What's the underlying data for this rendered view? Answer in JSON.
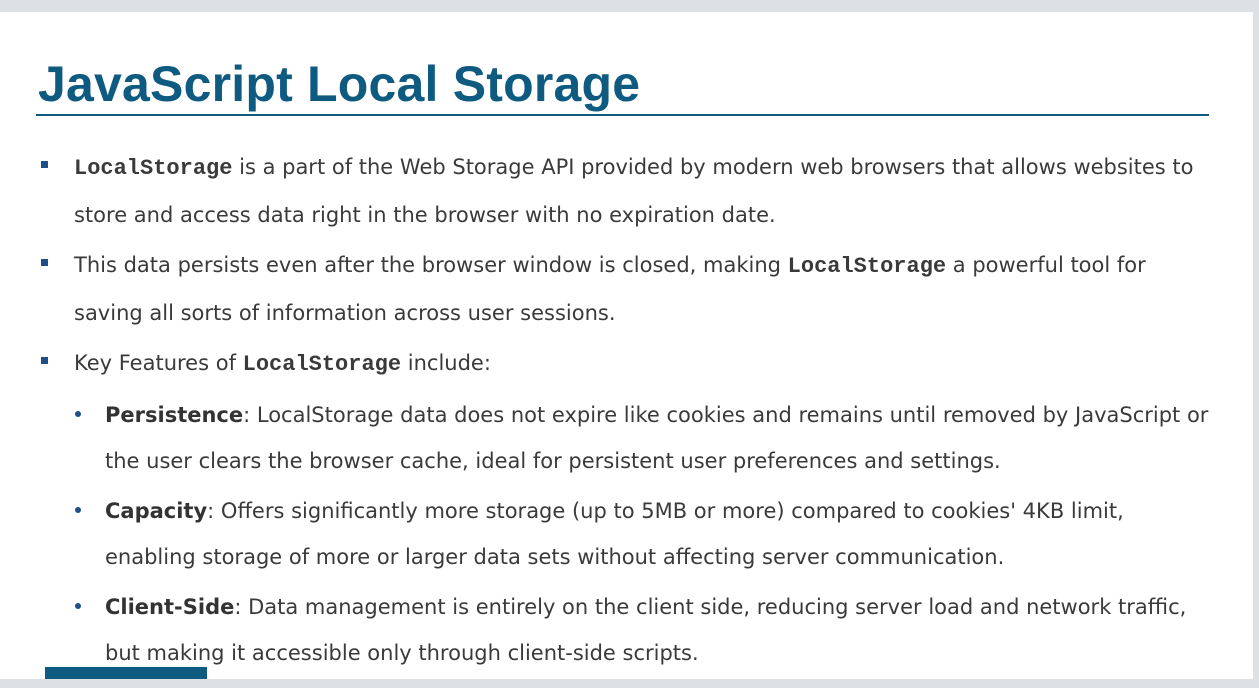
{
  "slide": {
    "title": "JavaScript Local Storage",
    "bullets": [
      {
        "code": "LocalStorage",
        "text": " is a part of the Web Storage API provided by modern web browsers that allows websites to store and access data right in the browser with no expiration date."
      },
      {
        "text_before": "This data persists even after the browser window is closed, making ",
        "code": "LocalStorage",
        "text_after": " a powerful tool for saving all sorts of information across user sessions."
      },
      {
        "text_before": "Key Features of ",
        "code": "LocalStorage",
        "text_after": " include:"
      }
    ],
    "features": [
      {
        "term": "Persistence",
        "text": ": LocalStorage data does not expire like cookies and remains until removed by JavaScript or the user clears the browser cache, ideal for persistent user preferences and settings."
      },
      {
        "term": "Capacity",
        "text": ": Offers significantly more storage (up to 5MB or more) compared to cookies' 4KB limit, enabling storage of more or larger data sets without affecting server communication."
      },
      {
        "term": "Client-Side",
        "text": ": Data management is entirely on the client side, reducing server load and network traffic, but making it accessible only through client-side scripts."
      }
    ],
    "colors": {
      "title": "#0e5a80",
      "bullet": "#1e4f86",
      "body_text": "#3a3a3a",
      "frame": "#dde1e4"
    }
  }
}
